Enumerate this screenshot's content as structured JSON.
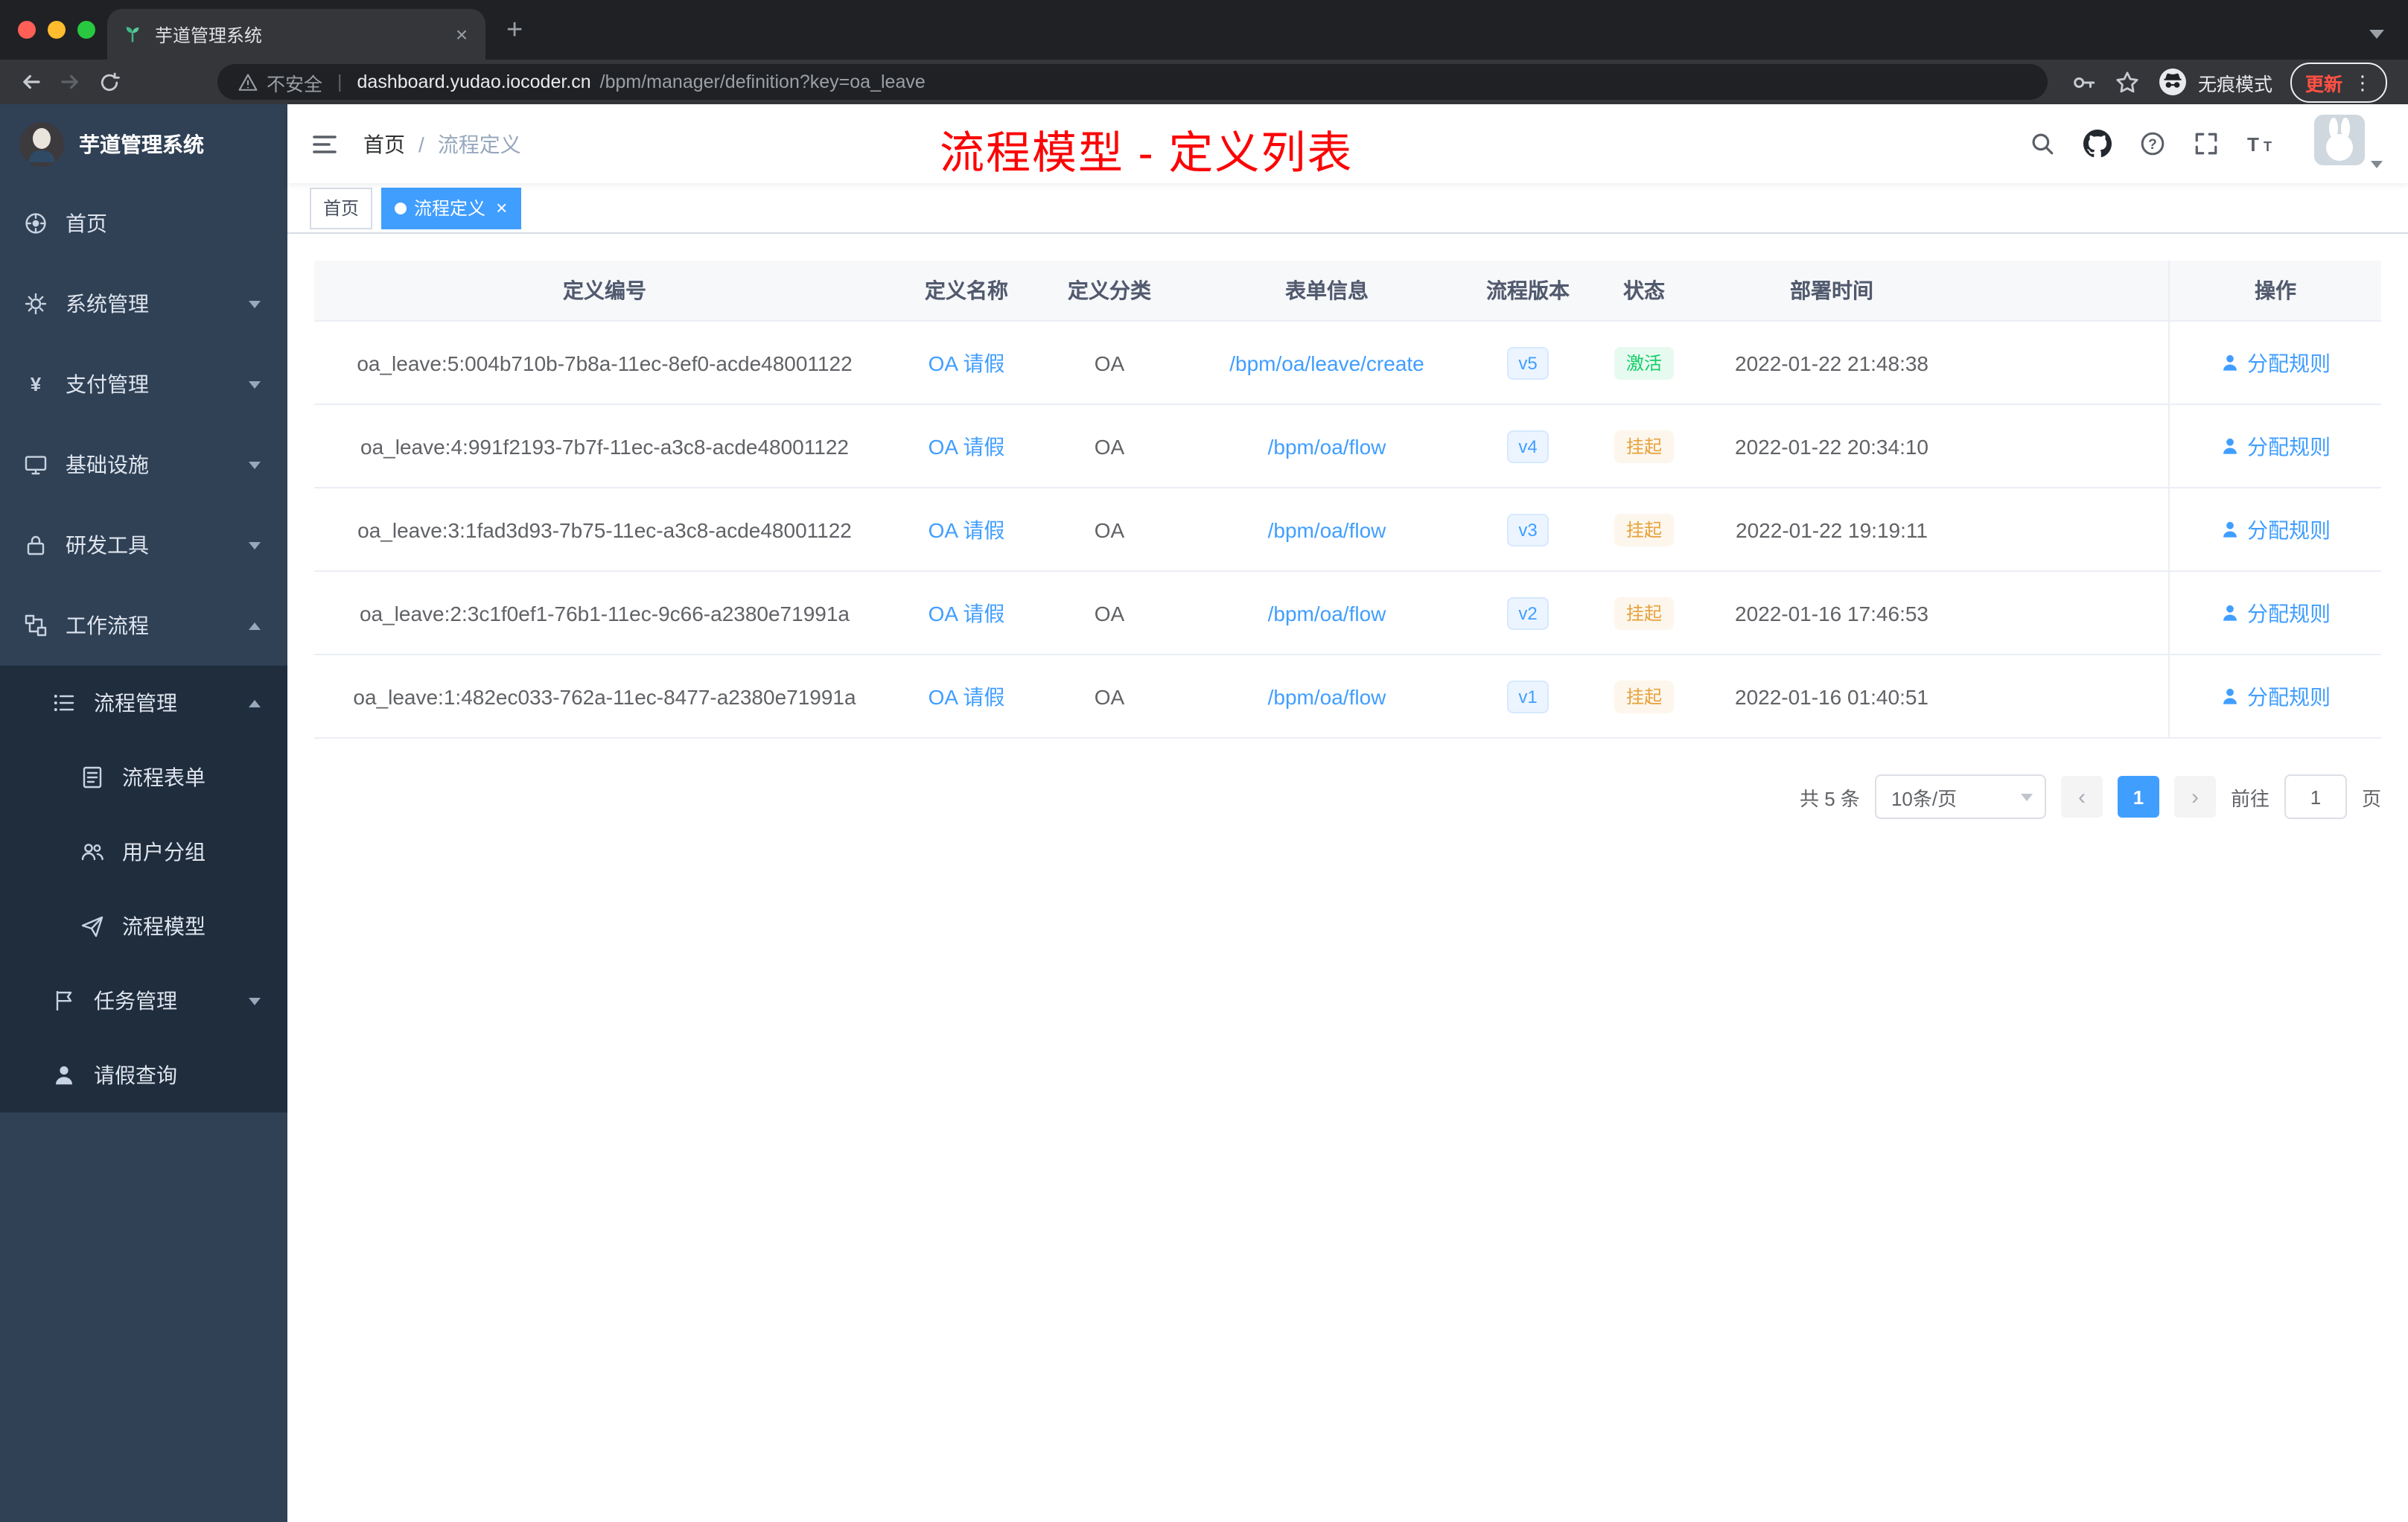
{
  "colors": {
    "accent": "#409eff",
    "annotation_red": "#fb0505",
    "sidebar_bg": "#304156",
    "submenu_bg": "#1f2d3d",
    "status_green": "#13ce66",
    "status_yellow": "#e6a23c"
  },
  "browser": {
    "tab_title": "芋道管理系统",
    "tab_close": "×",
    "new_tab": "+",
    "not_secure": "不安全",
    "url_domain": "dashboard.yudao.iocoder.cn",
    "url_path": "/bpm/manager/definition?key=oa_leave",
    "incognito_label": "无痕模式",
    "update_label": "更新",
    "menu_dots": "⋮"
  },
  "sidebar": {
    "logo": "芋道管理系统",
    "items": [
      {
        "label": "首页",
        "icon": "dashboard-icon"
      },
      {
        "label": "系统管理",
        "icon": "gear-icon"
      },
      {
        "label": "支付管理",
        "icon": "yen-icon"
      },
      {
        "label": "基础设施",
        "icon": "monitor-icon"
      },
      {
        "label": "研发工具",
        "icon": "lock-icon"
      },
      {
        "label": "工作流程",
        "icon": "workflow-icon"
      },
      {
        "label": "流程管理",
        "icon": "list-icon"
      },
      {
        "label": "流程表单",
        "icon": "form-icon"
      },
      {
        "label": "用户分组",
        "icon": "users-icon"
      },
      {
        "label": "流程模型",
        "icon": "send-icon"
      },
      {
        "label": "任务管理",
        "icon": "flag-icon"
      },
      {
        "label": "请假查询",
        "icon": "user-icon"
      }
    ]
  },
  "header": {
    "breadcrumb_home": "首页",
    "breadcrumb_sep": "/",
    "breadcrumb_current": "流程定义",
    "annotation": "流程模型 - 定义列表"
  },
  "tags": {
    "items": [
      {
        "label": "首页",
        "active": false
      },
      {
        "label": "流程定义",
        "active": true
      }
    ],
    "close": "×"
  },
  "table": {
    "columns": [
      "定义编号",
      "定义名称",
      "定义分类",
      "表单信息",
      "流程版本",
      "状态",
      "部署时间",
      "操作"
    ],
    "rows": [
      {
        "id": "oa_leave:5:004b710b-7b8a-11ec-8ef0-acde48001122",
        "name": "OA 请假",
        "category": "OA",
        "form": "/bpm/oa/leave/create",
        "version": "v5",
        "status": "激活",
        "status_type": "active",
        "time": "2022-01-22 21:48:38",
        "action": "分配规则"
      },
      {
        "id": "oa_leave:4:991f2193-7b7f-11ec-a3c8-acde48001122",
        "name": "OA 请假",
        "category": "OA",
        "form": "/bpm/oa/flow",
        "version": "v4",
        "status": "挂起",
        "status_type": "suspended",
        "time": "2022-01-22 20:34:10",
        "action": "分配规则"
      },
      {
        "id": "oa_leave:3:1fad3d93-7b75-11ec-a3c8-acde48001122",
        "name": "OA 请假",
        "category": "OA",
        "form": "/bpm/oa/flow",
        "version": "v3",
        "status": "挂起",
        "status_type": "suspended",
        "time": "2022-01-22 19:19:11",
        "action": "分配规则"
      },
      {
        "id": "oa_leave:2:3c1f0ef1-76b1-11ec-9c66-a2380e71991a",
        "name": "OA 请假",
        "category": "OA",
        "form": "/bpm/oa/flow",
        "version": "v2",
        "status": "挂起",
        "status_type": "suspended",
        "time": "2022-01-16 17:46:53",
        "action": "分配规则"
      },
      {
        "id": "oa_leave:1:482ec033-762a-11ec-8477-a2380e71991a",
        "name": "OA 请假",
        "category": "OA",
        "form": "/bpm/oa/flow",
        "version": "v1",
        "status": "挂起",
        "status_type": "suspended",
        "time": "2022-01-16 01:40:51",
        "action": "分配规则"
      }
    ]
  },
  "pagination": {
    "total": "共 5 条",
    "size": "10条/页",
    "prev": "‹",
    "current": "1",
    "next": "›",
    "goto": "前往",
    "goto_value": "1",
    "unit": "页"
  }
}
